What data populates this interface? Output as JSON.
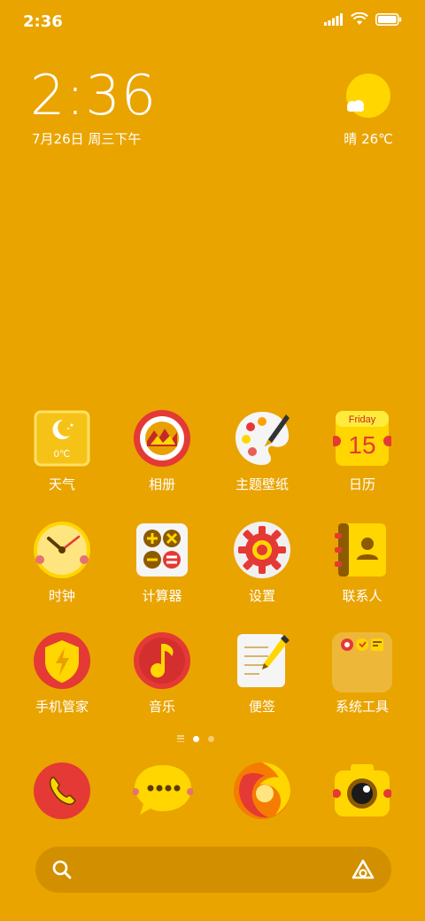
{
  "status_bar": {
    "time": "2:36"
  },
  "clock_widget": {
    "time": "2:36",
    "date": "7月26日 周三下午"
  },
  "weather_widget": {
    "text": "晴 26℃"
  },
  "apps": [
    {
      "id": "weather",
      "label": "天气",
      "temp": "0℃"
    },
    {
      "id": "gallery",
      "label": "相册"
    },
    {
      "id": "themes",
      "label": "主题壁纸"
    },
    {
      "id": "calendar",
      "label": "日历",
      "day_name": "Friday",
      "day_number": "15"
    },
    {
      "id": "clock",
      "label": "时钟"
    },
    {
      "id": "calculator",
      "label": "计算器"
    },
    {
      "id": "settings",
      "label": "设置"
    },
    {
      "id": "contacts",
      "label": "联系人"
    },
    {
      "id": "security",
      "label": "手机管家"
    },
    {
      "id": "music",
      "label": "音乐"
    },
    {
      "id": "notes",
      "label": "便签"
    },
    {
      "id": "tools",
      "label": "系统工具"
    }
  ],
  "dock": [
    "phone",
    "messages",
    "browser",
    "camera"
  ],
  "search": {
    "placeholder": ""
  },
  "colors": {
    "background": "#E9A400",
    "accent_red": "#E53935",
    "accent_yellow": "#FFD600"
  }
}
